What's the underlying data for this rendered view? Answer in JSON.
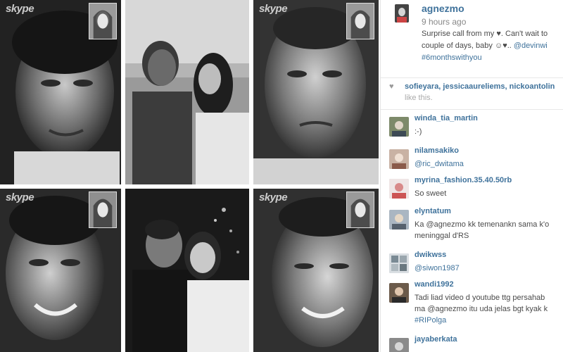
{
  "grid": {
    "skype_label": "skype"
  },
  "post": {
    "username": "agnezmo",
    "time_ago": "9 hours ago",
    "caption_line1": "Surprise call from my ♥. Can't wait to",
    "caption_line2_prefix": "couple of days, baby ☺♥.. ",
    "caption_mention": "@devinwi",
    "caption_hashtag": "#6monthswithyou"
  },
  "likes": {
    "icon": "heart-icon",
    "likers": "sofieyara, jessicaaureliems, nickoantolin",
    "suffix": "like this."
  },
  "comments": [
    {
      "user": "winda_tia_martin",
      "line1": ":-)",
      "line2": ""
    },
    {
      "user": "nilamsakiko",
      "line1": "@ric_dwitama",
      "line2": ""
    },
    {
      "user": "myrina_fashion.35.40.50rb",
      "line1": "So sweet",
      "line2": ""
    },
    {
      "user": "elyntatum",
      "line1": "Ka @agnezmo kk temenankn sama k'o",
      "line2": "meninggal d'RS"
    },
    {
      "user": "dwikwss",
      "line1": "@siwon1987",
      "line2": ""
    },
    {
      "user": "wandi1992",
      "line1": "Tadi liad video d youtube ttg persahab",
      "line2": "ma @agnezmo itu uda jelas bgt kyak k",
      "line3": "#RIPolga"
    },
    {
      "user": "jayaberkata",
      "line1": "",
      "line2": ""
    }
  ],
  "colors": {
    "link": "#3f729b",
    "text": "#4a4a4a",
    "muted": "#888888"
  }
}
